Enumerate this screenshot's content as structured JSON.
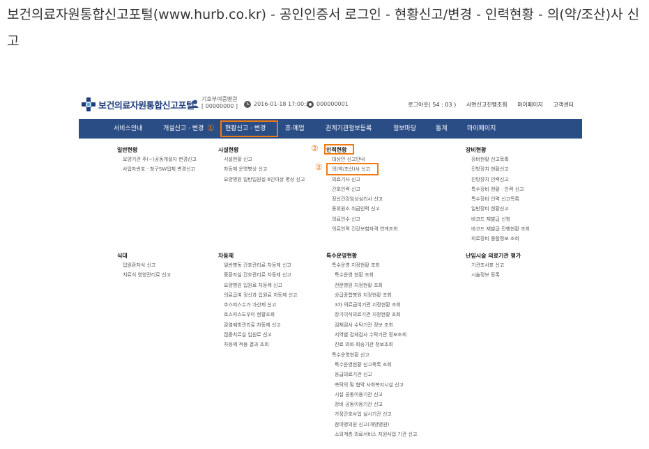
{
  "post_title": "보건의료자원통합신고포털(www.hurb.co.kr) - 공인인증서 로그인 - 현황신고/변경 - 인력현황 - 의(약/조산)사 신고",
  "header": {
    "logo_text": "보건의료자원통합신고포털",
    "user_line1": "기호부여중병원",
    "user_line2": "[ 00000000 ]",
    "login_time": "2016-01-18 17:00:33",
    "id_number": "000000001",
    "logout": "로그아웃( 54 : 03 )",
    "links": [
      "서면신고진행조회",
      "마이페이지",
      "고객센터"
    ]
  },
  "nav": [
    "서비스안내",
    "개설신고 · 변경",
    "현황신고 · 변경",
    "휴·폐업",
    "관계기관정보등록",
    "정보마당",
    "통계",
    "마이페이지"
  ],
  "markers": [
    "①",
    "②",
    "②"
  ],
  "menu": {
    "col1_top": {
      "title": "일반현황",
      "items": [
        "요양기관 주(~)공동개설자 변경신고",
        "사업자번호 · 청구SW업체 변경신고"
      ]
    },
    "col2_top": {
      "title": "시설현황",
      "items": [
        "시설현황 신고",
        "차등제 운영병상 신고",
        "요양병원 일반입원실 6인이상 병상 신고"
      ]
    },
    "col3_top": {
      "title": "인력현황",
      "items": [
        "대상인 신고안내",
        "의(약/조산)사 신고",
        "의료기사 신고",
        "간호인력 신고",
        "정신건강임상심리사 신고",
        "동위원소 취급인력 신고",
        "의료인수 신고",
        "의료인력 건강보험자격 연계조회"
      ]
    },
    "col4_top": {
      "title": "장비현황",
      "items": [
        "장비현황 신고목록",
        "진방장치 현황신고",
        "진방장치 인력신고",
        "특수장비 현황 · 인력 신고",
        "특수장비 인력 신고목록",
        "일반장비 현황신고",
        "바코드 재발급 신청",
        "바코드 재발급 진행현황 조회",
        "의료장비 종합정보 조회"
      ]
    },
    "col1_bot": {
      "title": "식대",
      "items": [
        "입원환자식 신고",
        "치료식 영양관리료 신고"
      ]
    },
    "col2_bot": {
      "title": "차등제",
      "items": [
        "일반병동 간호관리료 차등제 신고",
        "중환자실 간호관리료 차등제 신고",
        "요양병원 입원료 차등제 신고",
        "의료급여 정신과 입원료 차등제 신고",
        "호스피스수가 가산제 신고",
        "호스피스도우미 현황조회",
        "감염예방관리료 차등제 신고",
        "집중치료실 입원료 신고",
        "차등제 적용 결과 조회"
      ]
    },
    "col3_bot": {
      "title": "특수운영현황",
      "items": [
        "특수운영 지정현황 조회",
        "특수운영 현황 조회",
        "전문병원 지정현황 조회",
        "상급종합병원 지정현황 조회",
        "3차 의료급여기관 지정현황 조회",
        "장기이식의료기관 지정현황 조회",
        "검체검사 수탁기관 정보 조회",
        "지역별 검체검사 수탁기관 정보조회",
        "진료 의뢰·회송기관 정보조회",
        "특수운영현황 신고",
        "특수운영현황 신고목록 조회",
        "응급의료기관 신고",
        "촉탁의 및 협약 사회복지시설 신고",
        "시설 공동이용기관 신고",
        "장비 공동이용기관 신고",
        "가정간호사업 실시기관 신고",
        "참여병의원 신고(개방병원)",
        "소외계층 의료서비스 지원사업 기관 신고"
      ]
    },
    "col4_bot": {
      "title": "난임시술 의료기관 평가",
      "items": [
        "기관조사표 신고",
        "시술정보 등록"
      ]
    }
  },
  "colors": {
    "nav_bg": "#2b4d85",
    "highlight": "#f07a12",
    "logo": "#1f3d7a"
  }
}
